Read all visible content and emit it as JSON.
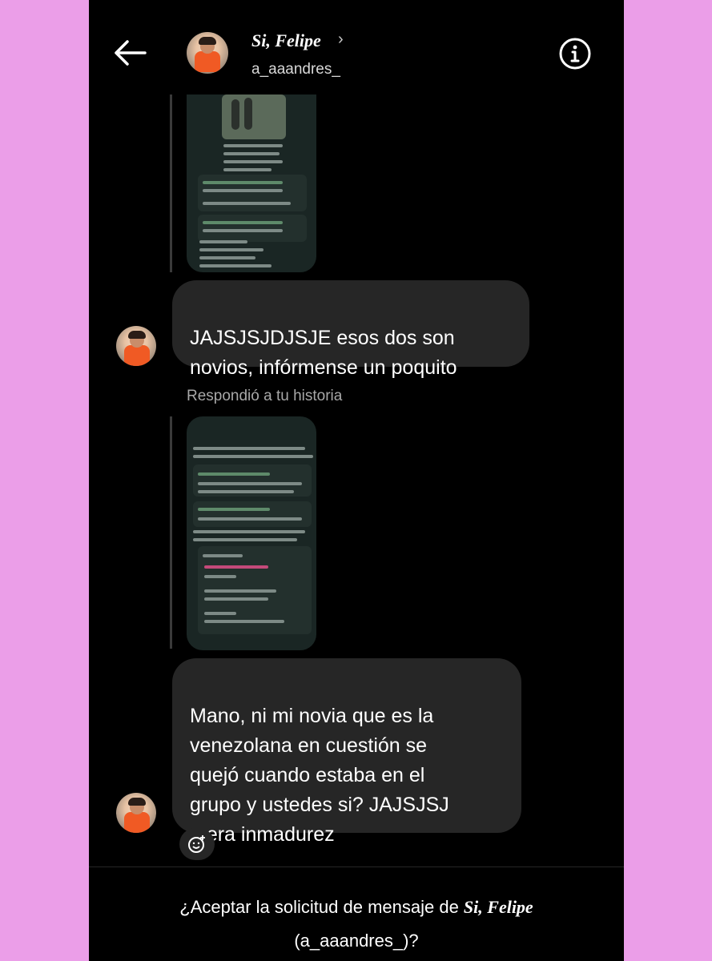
{
  "header": {
    "name": "Si, Felipe",
    "chevron": "›",
    "username": "a_aaandres_",
    "back_icon": "arrow-left-icon",
    "info_icon": "info-circle-icon"
  },
  "messages": [
    {
      "text": "JAJSJSJDJSJE esos dos son\nnovios, infórmense un poquito"
    },
    {
      "text": "Mano, ni mi novia que es la\nvenezolana en cuestión se\nquejó cuando estaba en el\ngrupo y ustedes si? JAJSJSJ\nmera inmadurez"
    }
  ],
  "replied_label": "Respondió a tu historia",
  "accept_request": {
    "prefix": "¿Aceptar la solicitud de mensaje de ",
    "name": "Si, Felipe",
    "handle": "(a_aaandres_)?"
  },
  "colors": {
    "page_background": "#eb9ee8",
    "screen_background": "#000000",
    "bubble": "#262626",
    "secondary_text": "#a8a8a8"
  }
}
